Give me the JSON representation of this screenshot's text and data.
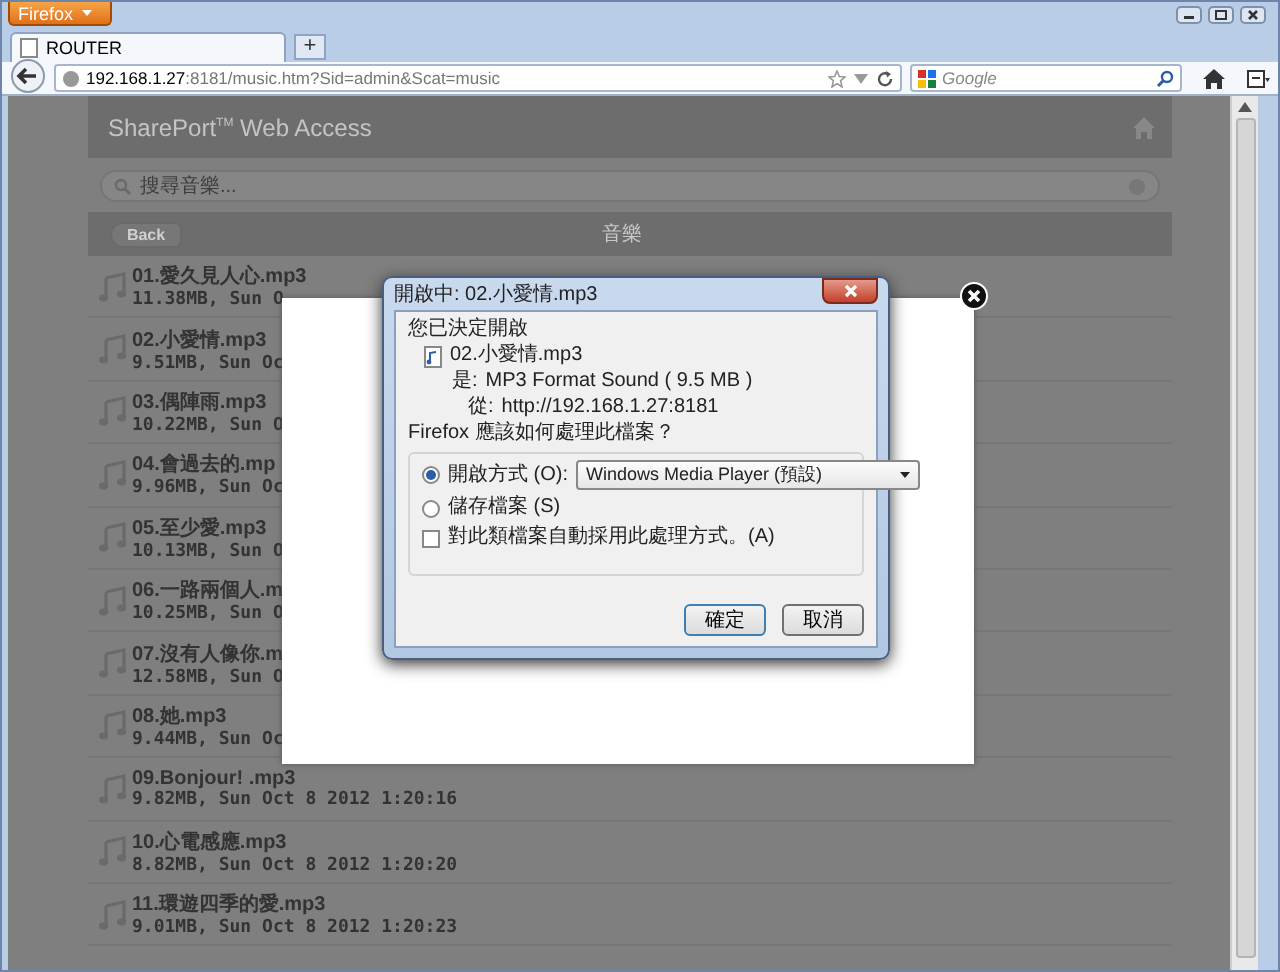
{
  "browser": {
    "menu_button": "Firefox",
    "tabs": [
      {
        "title": "ROUTER",
        "selected": true
      }
    ],
    "new_tab": "+",
    "url": {
      "host": "192.168.1.27",
      "rest": ":8181/music.htm?Sid=admin&Scat=music"
    },
    "search": {
      "placeholder": "Google"
    }
  },
  "page": {
    "title": "SharePort$^{TM}$ Web Access",
    "search_placeholder": "搜尋音樂...",
    "back": "Back",
    "heading": "音樂",
    "tracks": [
      {
        "name": "01.愛久見人心.mp3",
        "info": "11.38MB, Sun O"
      },
      {
        "name": "02.小愛情.mp3",
        "info": "9.51MB, Sun Oc"
      },
      {
        "name": "03.偶陣雨.mp3",
        "info": "10.22MB, Sun O"
      },
      {
        "name": "04.會過去的.mp",
        "info": "9.96MB, Sun Oc"
      },
      {
        "name": "05.至少愛.mp3",
        "info": "10.13MB, Sun O"
      },
      {
        "name": "06.一路兩個人.m",
        "info": "10.25MB, Sun O"
      },
      {
        "name": "07.沒有人像你.m",
        "info": "12.58MB, Sun O"
      },
      {
        "name": "08.她.mp3",
        "info": "9.44MB, Sun Oc"
      },
      {
        "name": "09.Bonjour! .mp3",
        "info": "9.82MB, Sun Oct 8 2012 1:20:16"
      },
      {
        "name": "10.心電感應.mp3",
        "info": "8.82MB, Sun Oct 8 2012 1:20:20"
      },
      {
        "name": "11.環遊四季的愛.mp3",
        "info": "9.01MB, Sun Oct 8 2012 1:20:23"
      }
    ]
  },
  "dialog": {
    "title": "開啟中: 02.小愛情.mp3",
    "intro": "您已決定開啟",
    "file": "02.小愛情.mp3",
    "type_label": "是:",
    "type_value": "MP3 Format Sound ( 9.5 MB )",
    "from_label": "從:",
    "from_value": "http://192.168.1.27:8181",
    "question": "Firefox 應該如何處理此檔案？",
    "options": [
      {
        "label": "開啟方式 (O):",
        "selected": true
      },
      {
        "label": "儲存檔案 (S)",
        "selected": false
      }
    ],
    "app": "Windows Media Player (預設)",
    "remember": {
      "label": "對此類檔案自動採用此處理方式。(A)",
      "checked": false
    },
    "buttons": [
      "確定",
      "取消"
    ]
  }
}
